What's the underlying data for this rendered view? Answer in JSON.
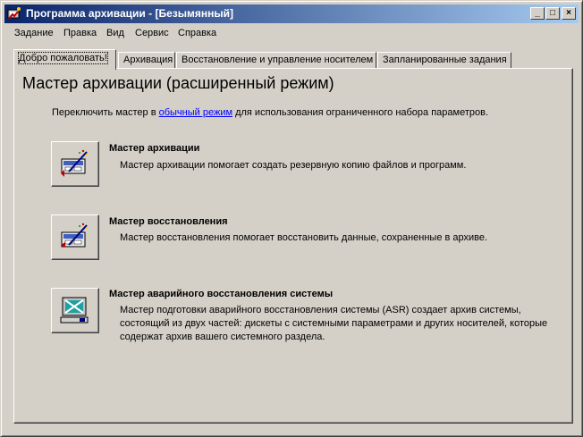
{
  "window": {
    "title": "Программа архивации - [Безымянный]",
    "minimize_label": "_",
    "maximize_label": "□",
    "close_label": "×"
  },
  "menu": [
    {
      "label": "Задание"
    },
    {
      "label": "Правка"
    },
    {
      "label": "Вид"
    },
    {
      "label": "Сервис"
    },
    {
      "label": "Справка"
    }
  ],
  "tabs": [
    {
      "label": "Добро пожаловать!",
      "active": true
    },
    {
      "label": "Архивация",
      "active": false
    },
    {
      "label": "Восстановление и управление носителем",
      "active": false
    },
    {
      "label": "Запланированные задания",
      "active": false
    }
  ],
  "welcome": {
    "heading": "Мастер архивации (расширенный режим)",
    "intro_before": "Переключить мастер в ",
    "intro_link": "обычный режим",
    "intro_after": " для использования ограниченного набора параметров."
  },
  "wizards": [
    {
      "title": "Мастер архивации",
      "description": "Мастер архивации помогает создать резервную копию файлов и программ.",
      "icon": "backup-wizard-icon"
    },
    {
      "title": "Мастер восстановления",
      "description": "Мастер восстановления помогает восстановить данные, сохраненные в архиве.",
      "icon": "restore-wizard-icon"
    },
    {
      "title": "Мастер аварийного восстановления системы",
      "description": "Мастер подготовки аварийного восстановления системы (ASR) создает архив системы, состоящий из двух частей: дискеты с системными параметрами и других носителей, которые содержат архив вашего системного раздела.",
      "icon": "asr-wizard-icon"
    }
  ],
  "colors": {
    "titlebar_start": "#0a246a",
    "titlebar_end": "#a6caf0",
    "face": "#d4d0c8",
    "link": "#0000ff"
  }
}
